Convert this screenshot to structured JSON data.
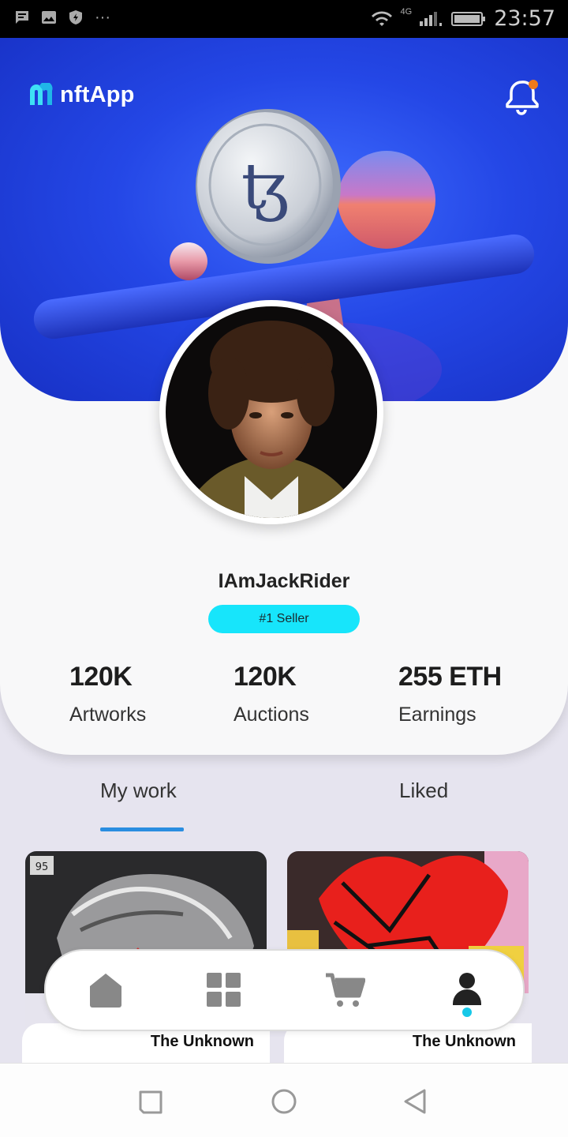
{
  "status_bar": {
    "time": "23:57",
    "network": "4G",
    "left_icons": [
      "message-icon",
      "image-icon",
      "shield-icon"
    ],
    "more": "···"
  },
  "header": {
    "app_name": "nftApp",
    "logo_icon": "nftapp-logo-icon",
    "notification_icon": "bell-icon",
    "notification_dot_color": "#f07a1a"
  },
  "profile": {
    "username": "IAmJackRider",
    "badge": "#1 Seller",
    "stats": [
      {
        "value": "120K",
        "label": "Artworks"
      },
      {
        "value": "120K",
        "label": "Auctions"
      },
      {
        "value": "255 ETH",
        "label": "Earnings"
      }
    ]
  },
  "tabs": [
    {
      "label": "My work",
      "active": true
    },
    {
      "label": "Liked",
      "active": false
    }
  ],
  "artworks": [
    {
      "title": "The Unknown"
    },
    {
      "title": "The Unknown"
    }
  ],
  "bottom_nav": [
    {
      "icon": "home-icon",
      "active": false
    },
    {
      "icon": "grid-icon",
      "active": false
    },
    {
      "icon": "cart-icon",
      "active": false
    },
    {
      "icon": "profile-icon",
      "active": true
    }
  ],
  "system_nav": [
    "recents-icon",
    "home-circle-icon",
    "back-icon"
  ],
  "colors": {
    "accent": "#17e5fb",
    "banner": "#2447e6",
    "tab_indicator": "#2a8de0"
  }
}
